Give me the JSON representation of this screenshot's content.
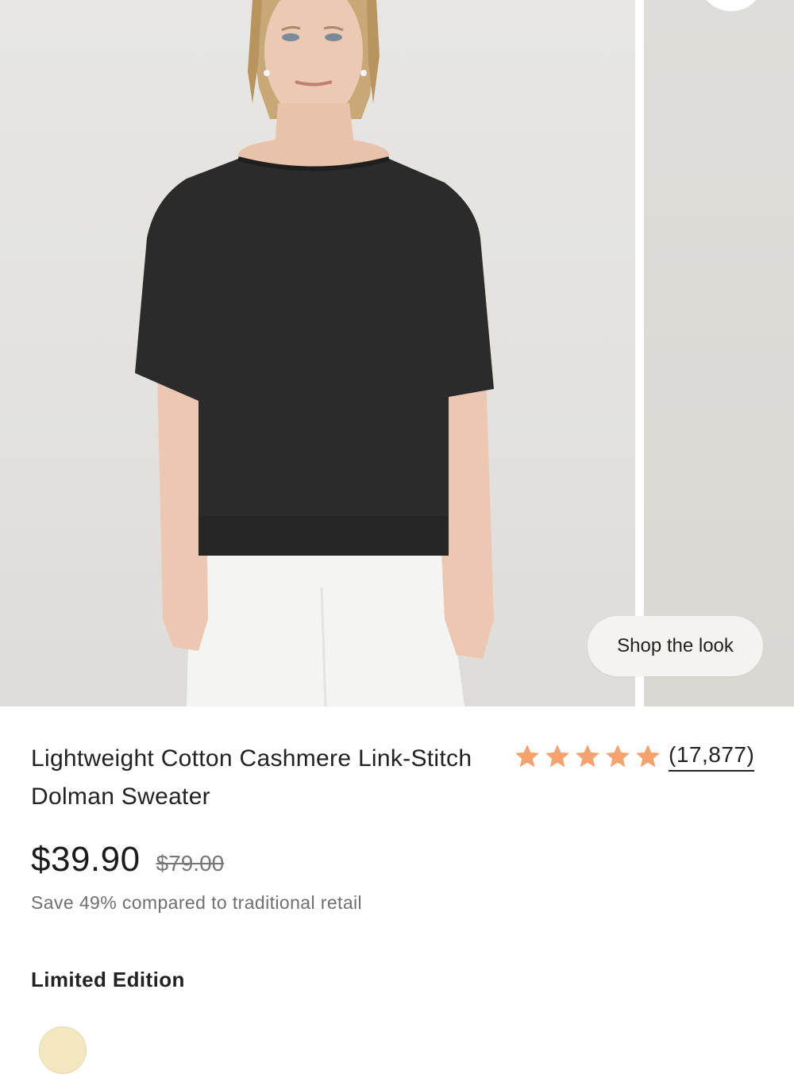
{
  "gallery": {
    "shop_the_look_label": "Shop the look"
  },
  "product": {
    "title": "Lightweight Cotton Cashmere Link-Stitch Dolman Sweater",
    "rating_stars": 5,
    "review_count": "(17,877)",
    "price": "$39.90",
    "original_price": "$79.00",
    "savings_text": "Save 49% compared to traditional retail",
    "edition_label": "Limited Edition",
    "swatches": [
      {
        "name": "cream",
        "color": "#f3e7bf"
      }
    ]
  },
  "colors": {
    "star": "#f4a36f",
    "sweater": "#2a2a2a",
    "background": "#e6e5e2"
  }
}
